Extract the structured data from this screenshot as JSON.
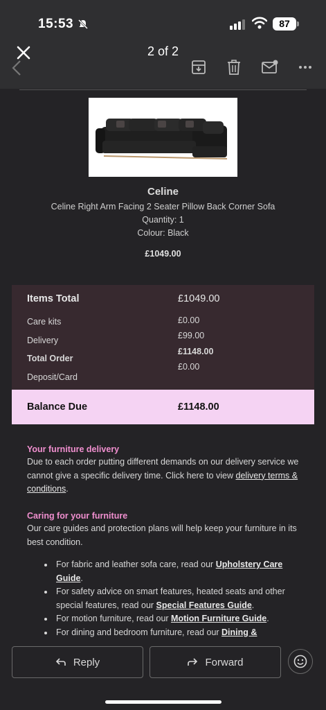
{
  "status_bar": {
    "time": "15:53",
    "battery": "87"
  },
  "header": {
    "pager": "2 of 2"
  },
  "product": {
    "name": "Celine",
    "description": "Celine Right Arm Facing 2 Seater Pillow Back Corner Sofa",
    "quantity": "Quantity: 1",
    "colour": "Colour: Black",
    "price": "£1049.00"
  },
  "totals": {
    "items_total_label": "Items Total",
    "items_total_value": "£1049.00",
    "care_kits_label": "Care kits",
    "care_kits_value": "£0.00",
    "delivery_label": "Delivery",
    "delivery_value": "£99.00",
    "total_order_label": "Total Order",
    "total_order_value": "£1148.00",
    "deposit_label": "Deposit/Card",
    "deposit_value": "£0.00",
    "balance_label": "Balance Due",
    "balance_value": "£1148.00"
  },
  "delivery_section": {
    "title": "Your furniture delivery",
    "text_1": "Due to each order putting different demands on our delivery service we cannot give a specific delivery time. Click here to view ",
    "link": "delivery terms & conditions",
    "text_2": "."
  },
  "care_section": {
    "title": "Caring for your furniture",
    "text": "Our care guides and protection plans will help keep your furniture in its best condition.",
    "bullets": [
      {
        "text": "For fabric and leather sofa care, read our ",
        "link": "Upholstery Care Guide",
        "end": "."
      },
      {
        "text": "For safety advice on smart features, heated seats and other special features, read our ",
        "link": "Special Features Guide",
        "end": "."
      },
      {
        "text": "For motion furniture, read our ",
        "link": "Motion Furniture Guide",
        "end": "."
      },
      {
        "text": "For dining and bedroom furniture, read our ",
        "link": "Dining &",
        "end": ""
      }
    ]
  },
  "actions": {
    "reply": "Reply",
    "forward": "Forward"
  }
}
